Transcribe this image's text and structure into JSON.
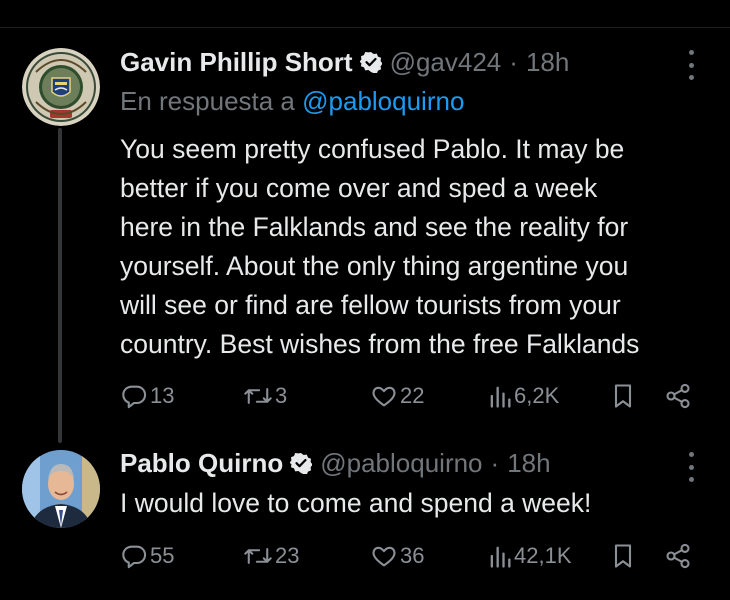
{
  "tweets": [
    {
      "author_name": "Gavin Phillip Short",
      "handle": "@gav424",
      "separator": "·",
      "time": "18h",
      "reply_prefix": "En respuesta a",
      "reply_mention": "@pabloquirno",
      "text": "You seem pretty confused Pablo. It may be\nbetter if you come over and sped a week\nhere in the Falklands and see the reality for\nyourself. About the only thing argentine you\nwill see or find are fellow tourists from your\ncountry. Best wishes from the free Falklands",
      "replies": "13",
      "reposts": "3",
      "likes": "22",
      "views": "6,2K"
    },
    {
      "author_name": "Pablo Quirno",
      "handle": "@pabloquirno",
      "separator": "·",
      "time": "18h",
      "text": "I would love to come and spend a week!",
      "replies": "55",
      "reposts": "23",
      "likes": "36",
      "views": "42,1K"
    }
  ],
  "icons": [
    "verified-badge-icon",
    "more-icon",
    "reply-icon",
    "repost-icon",
    "like-icon",
    "views-icon",
    "bookmark-icon",
    "share-icon"
  ],
  "colors": {
    "background": "#000000",
    "text": "#e7e9ea",
    "secondary": "#71767b",
    "link": "#1d9bf0"
  }
}
